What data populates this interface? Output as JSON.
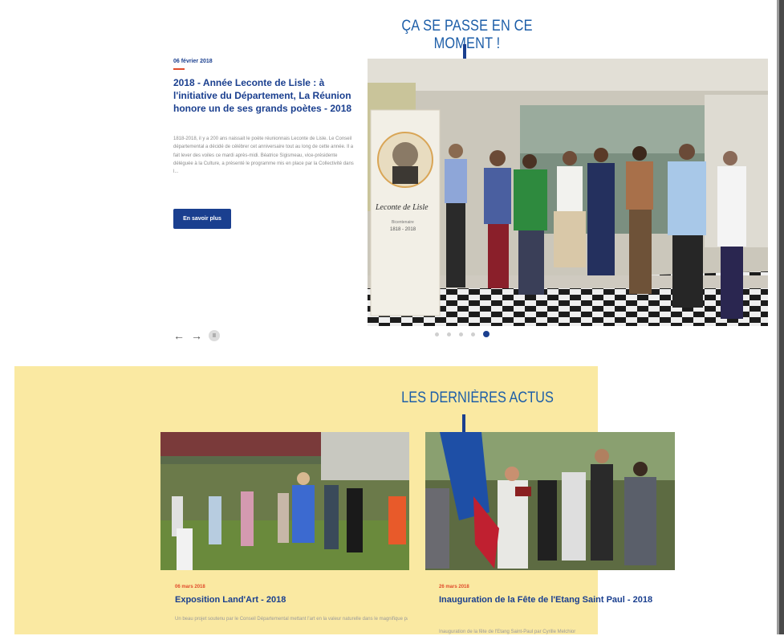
{
  "section_now": {
    "title": "ÇA SE PASSE EN CE MOMENT !",
    "featured": {
      "date": "06 février 2018",
      "title": "2018 - Année Leconte de Lisle : à l'initiative du Département, La Réunion honore un de ses grands poètes - 2018",
      "excerpt": "1818-2018, il y a 200 ans naissait le poète réunionnais Leconte de Lisle. Le Conseil départemental a décidé de célébrer cet anniversaire tout au long de cette année. Il a fait lever des voiles ce mardi après-midi. Béatrice Sigismeau, vice-présidente déléguée à la Culture, a présenté le programme mis en place par la Collectivité dans l...",
      "button_label": "En savoir plus"
    },
    "poster": {
      "signature": "Leconte de Lisle",
      "subtitle": "Bicentenaire",
      "years": "1818 - 2018"
    },
    "carousel": {
      "prev": "←",
      "next": "→",
      "pause": "II",
      "dot_count": 5,
      "active_dot": 4
    }
  },
  "section_news": {
    "title": "LES DERNIÈRES ACTUS",
    "cards": [
      {
        "date": "06 mars 2018",
        "title": "Exposition Land'Art - 2018",
        "excerpt": "Un beau projet soutenu par le Conseil Départemental mettant l'art en la valeur naturelle dans le magnifique parc de Mascarin, jardin botanique"
      },
      {
        "date": "26 mars 2018",
        "title": "Inauguration de la Fête de l'Etang Saint Paul - 2018",
        "excerpt": "Inauguration de la fête de l'Etang Saint-Paul par Cyrille Melchior"
      }
    ]
  },
  "icons": [
    "arrow-left-icon",
    "arrow-right-icon",
    "pause-icon"
  ],
  "colors": {
    "brand_blue": "#1a3f8f",
    "accent_red": "#e04b2b",
    "band_yellow": "#fae9a2"
  }
}
